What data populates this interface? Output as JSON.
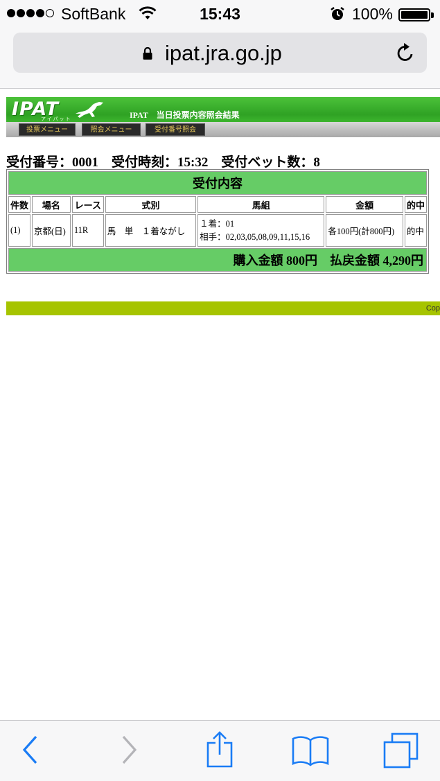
{
  "status_bar": {
    "carrier": "SoftBank",
    "time": "15:43",
    "battery_percent": "100%",
    "signal_bars_filled": 4,
    "signal_bars_total": 5
  },
  "browser": {
    "url": "ipat.jra.go.jp"
  },
  "ipat": {
    "logo": "IPAT",
    "logo_sub": "アイパット",
    "page_title": "IPAT　当日投票内容照会結果",
    "menu": [
      "投票メニュー",
      "照会メニュー",
      "受付番号照会"
    ],
    "receipt_line": "受付番号：0001　受付時刻：15:32　受付ベット数：8",
    "table": {
      "caption": "受付内容",
      "headers": [
        "件数",
        "場名",
        "レース",
        "式別",
        "馬組",
        "金額",
        "的中"
      ],
      "row": {
        "count": "(1)",
        "venue": "京都(日)",
        "race": "11R",
        "bet_type": "馬　単　１着ながし",
        "combo_first": "１着：01",
        "combo_partners": "相手：02,03,05,08,09,11,15,16",
        "amount": "各100円(計800円)",
        "hit": "的中"
      },
      "total": "購入金額 800円　払戻金額 4,290円"
    },
    "footer_copyright": "Cop"
  },
  "toolbar": {
    "icons": [
      "back-icon",
      "forward-icon",
      "share-icon",
      "bookmarks-icon",
      "tabs-icon"
    ]
  },
  "colors": {
    "ipat_green": "#2fa224",
    "table_green": "#66cc66",
    "footer_lime": "#a6c400",
    "ios_blue": "#1a7cf5",
    "menu_gold": "#e6c85a"
  }
}
